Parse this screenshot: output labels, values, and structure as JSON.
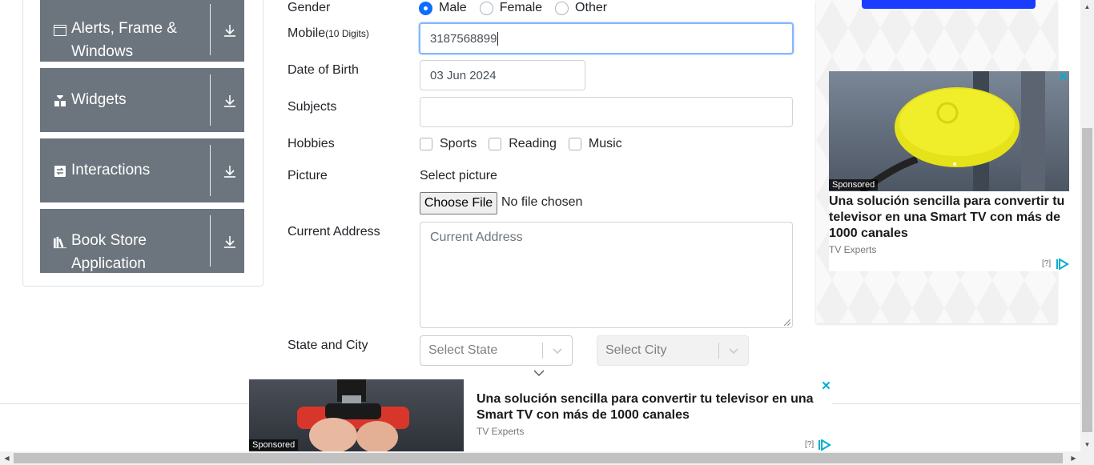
{
  "sidebar": {
    "groups": [
      {
        "label": "Alerts, Frame & Windows",
        "icon": "window-icon"
      },
      {
        "label": "Widgets",
        "icon": "widgets-icon"
      },
      {
        "label": "Interactions",
        "icon": "interactions-icon"
      },
      {
        "label": "Book Store Application",
        "icon": "books-icon"
      }
    ]
  },
  "form": {
    "gender": {
      "label": "Gender",
      "options": [
        "Male",
        "Female",
        "Other"
      ],
      "selected": "Male"
    },
    "mobile": {
      "label": "Mobile",
      "hint": "(10 Digits)",
      "value": "3187568899"
    },
    "dob": {
      "label": "Date of Birth",
      "value": "03 Jun 2024"
    },
    "subjects": {
      "label": "Subjects",
      "value": ""
    },
    "hobbies": {
      "label": "Hobbies",
      "options": [
        "Sports",
        "Reading",
        "Music"
      ]
    },
    "picture": {
      "label": "Picture",
      "select_text": "Select picture",
      "button": "Choose File",
      "status": "No file chosen"
    },
    "address": {
      "label": "Current Address",
      "placeholder": "Current Address"
    },
    "state_city": {
      "label": "State and City",
      "state_placeholder": "Select State",
      "city_placeholder": "Select City"
    }
  },
  "right_ad": {
    "sponsored": "Sponsored",
    "headline": "Una solución sencilla para convertir tu televisor en una Smart TV con más de 1000 canales",
    "source": "TV Experts",
    "info": "[?]",
    "close": "✕"
  },
  "bottom_ad": {
    "sponsored": "Sponsored",
    "headline": "Una solución sencilla para convertir tu televisor en una Smart TV con más de 1000 canales",
    "source": "TV Experts",
    "info": "[?]",
    "close": "✕"
  },
  "colors": {
    "sidebar_bg": "#6c757d",
    "accent": "#0d6efd",
    "ad_blue": "#00aecd"
  }
}
